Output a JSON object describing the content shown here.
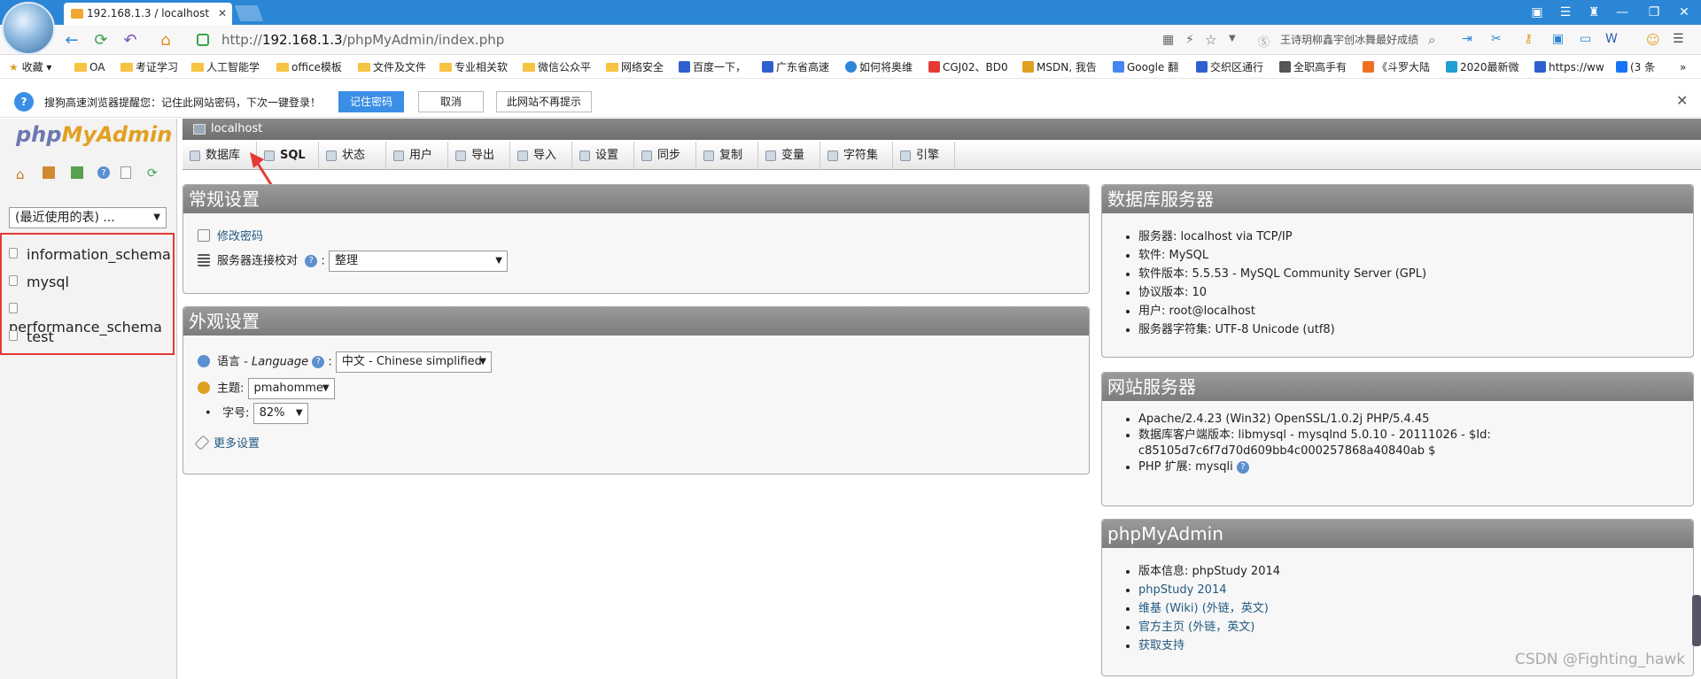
{
  "browser": {
    "tab_title": "192.168.1.3 / localhost",
    "tab_close": "✕",
    "url_prefix": "http://",
    "url_host": "192.168.1.3",
    "url_path": "/phpMyAdmin/index.php",
    "search_text": "王诗玥柳鑫宇创冰舞最好成绩",
    "bookmarks": [
      "收藏",
      "OA",
      "考证学习",
      "人工智能学",
      "office模板",
      "文件及文件",
      "专业相关软",
      "微信公众平",
      "网络安全",
      "百度一下，",
      "广东省高速",
      "如何将奥维",
      "CGJ02、BD0",
      "MSDN, 我告",
      "Google 翻",
      "交织区通行",
      "全职高手有",
      "《斗罗大陆",
      "2020最新微",
      "https://ww",
      "(3 条"
    ]
  },
  "infobar": {
    "text": "搜狗高速浏览器提醒您：记住此网站密码，下次一键登录！",
    "remember": "记住密码",
    "cancel": "取消",
    "never": "此网站不再提示"
  },
  "left": {
    "logo_php": "php",
    "logo_myadmin": "MyAdmin",
    "recent": "(最近使用的表) ...",
    "databases": [
      "information_schema",
      "mysql",
      "performance_schema",
      "test"
    ]
  },
  "server_bar": "localhost",
  "menu": [
    "数据库",
    "SQL",
    "状态",
    "用户",
    "导出",
    "导入",
    "设置",
    "同步",
    "复制",
    "变量",
    "字符集",
    "引擎"
  ],
  "general": {
    "title": "常规设置",
    "change_password": "修改密码",
    "collation_label": "服务器连接校对",
    "collation_value": "整理"
  },
  "appearance": {
    "title": "外观设置",
    "language_label": "语言 - ",
    "language_italic": "Language",
    "language_value": "中文 - Chinese simplified",
    "theme_label": "主题:",
    "theme_value": "pmahomme",
    "font_label": "字号:",
    "font_value": "82%",
    "more": "更多设置"
  },
  "db_server": {
    "title": "数据库服务器",
    "items": [
      "服务器: localhost via TCP/IP",
      "软件: MySQL",
      "软件版本: 5.5.53 - MySQL Community Server (GPL)",
      "协议版本: 10",
      "用户: root@localhost",
      "服务器字符集: UTF-8 Unicode (utf8)"
    ]
  },
  "web_server": {
    "title": "网站服务器",
    "item1": "Apache/2.4.23 (Win32) OpenSSL/1.0.2j PHP/5.4.45",
    "item2a": "数据库客户端版本: libmysql - mysqlnd 5.0.10 - 20111026 - $Id:",
    "item2b": "c85105d7c6f7d70d609bb4c000257868a40840ab $",
    "item3": "PHP 扩展: mysqli"
  },
  "pma_panel": {
    "title": "phpMyAdmin",
    "version": "版本信息: phpStudy 2014",
    "links": [
      "phpStudy 2014",
      "维基 (Wiki) (外链，英文)",
      "官方主页 (外链，英文)",
      "获取支持"
    ]
  },
  "watermark": "CSDN @Fighting_hawk",
  "colors": {
    "accent_blue": "#2b87d6",
    "pma_orange": "#e2a023",
    "highlight_red": "#e53935"
  }
}
